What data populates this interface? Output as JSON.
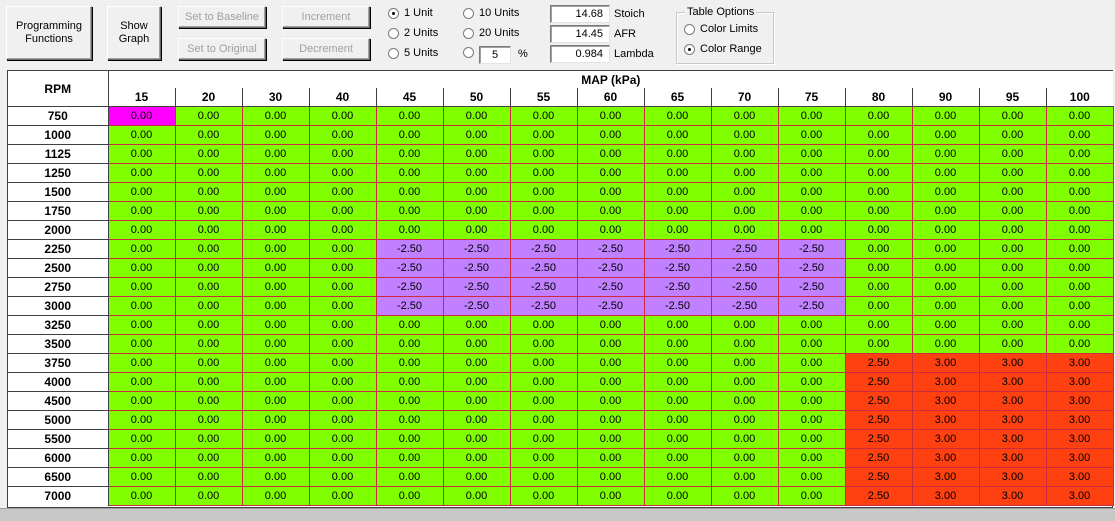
{
  "toolbar": {
    "programming_functions": "Programming\nFunctions",
    "show_graph": "Show\nGraph",
    "set_to_baseline": "Set to Baseline",
    "set_to_original": "Set to Original",
    "increment": "Increment",
    "decrement": "Decrement"
  },
  "increment_options": {
    "one_unit": "1 Unit",
    "two_units": "2 Units",
    "five_units": "5 Units",
    "ten_units": "10 Units",
    "twenty_units": "20 Units",
    "percent_value": "5",
    "percent_symbol": "%",
    "selected": "1 Unit"
  },
  "fuel": {
    "stoich_value": "14.68",
    "stoich_label": "Stoich",
    "afr_value": "14.45",
    "afr_label": "AFR",
    "lambda_value": "0.984",
    "lambda_label": "Lambda"
  },
  "table_options": {
    "title": "Table Options",
    "color_limits": "Color Limits",
    "color_range": "Color Range",
    "selected": "Color Range"
  },
  "colors": {
    "zero": "#80ff00",
    "negative": "#c080ff",
    "positive": "#ff4010",
    "selected": "#ff00ff",
    "grid_line": "#cc2a40"
  },
  "table": {
    "row_axis_label": "RPM",
    "col_axis_label": "MAP (kPa)",
    "columns": [
      "15",
      "20",
      "30",
      "40",
      "45",
      "50",
      "55",
      "60",
      "65",
      "70",
      "75",
      "80",
      "90",
      "95",
      "100"
    ],
    "rows": [
      "750",
      "1000",
      "1125",
      "1250",
      "1500",
      "1750",
      "2000",
      "2250",
      "2500",
      "2750",
      "3000",
      "3250",
      "3500",
      "3750",
      "4000",
      "4500",
      "5000",
      "5500",
      "6000",
      "6500",
      "7000"
    ],
    "selected_cell": [
      0,
      0
    ],
    "values": [
      [
        "0.00",
        "0.00",
        "0.00",
        "0.00",
        "0.00",
        "0.00",
        "0.00",
        "0.00",
        "0.00",
        "0.00",
        "0.00",
        "0.00",
        "0.00",
        "0.00",
        "0.00"
      ],
      [
        "0.00",
        "0.00",
        "0.00",
        "0.00",
        "0.00",
        "0.00",
        "0.00",
        "0.00",
        "0.00",
        "0.00",
        "0.00",
        "0.00",
        "0.00",
        "0.00",
        "0.00"
      ],
      [
        "0.00",
        "0.00",
        "0.00",
        "0.00",
        "0.00",
        "0.00",
        "0.00",
        "0.00",
        "0.00",
        "0.00",
        "0.00",
        "0.00",
        "0.00",
        "0.00",
        "0.00"
      ],
      [
        "0.00",
        "0.00",
        "0.00",
        "0.00",
        "0.00",
        "0.00",
        "0.00",
        "0.00",
        "0.00",
        "0.00",
        "0.00",
        "0.00",
        "0.00",
        "0.00",
        "0.00"
      ],
      [
        "0.00",
        "0.00",
        "0.00",
        "0.00",
        "0.00",
        "0.00",
        "0.00",
        "0.00",
        "0.00",
        "0.00",
        "0.00",
        "0.00",
        "0.00",
        "0.00",
        "0.00"
      ],
      [
        "0.00",
        "0.00",
        "0.00",
        "0.00",
        "0.00",
        "0.00",
        "0.00",
        "0.00",
        "0.00",
        "0.00",
        "0.00",
        "0.00",
        "0.00",
        "0.00",
        "0.00"
      ],
      [
        "0.00",
        "0.00",
        "0.00",
        "0.00",
        "0.00",
        "0.00",
        "0.00",
        "0.00",
        "0.00",
        "0.00",
        "0.00",
        "0.00",
        "0.00",
        "0.00",
        "0.00"
      ],
      [
        "0.00",
        "0.00",
        "0.00",
        "0.00",
        "-2.50",
        "-2.50",
        "-2.50",
        "-2.50",
        "-2.50",
        "-2.50",
        "-2.50",
        "0.00",
        "0.00",
        "0.00",
        "0.00"
      ],
      [
        "0.00",
        "0.00",
        "0.00",
        "0.00",
        "-2.50",
        "-2.50",
        "-2.50",
        "-2.50",
        "-2.50",
        "-2.50",
        "-2.50",
        "0.00",
        "0.00",
        "0.00",
        "0.00"
      ],
      [
        "0.00",
        "0.00",
        "0.00",
        "0.00",
        "-2.50",
        "-2.50",
        "-2.50",
        "-2.50",
        "-2.50",
        "-2.50",
        "-2.50",
        "0.00",
        "0.00",
        "0.00",
        "0.00"
      ],
      [
        "0.00",
        "0.00",
        "0.00",
        "0.00",
        "-2.50",
        "-2.50",
        "-2.50",
        "-2.50",
        "-2.50",
        "-2.50",
        "-2.50",
        "0.00",
        "0.00",
        "0.00",
        "0.00"
      ],
      [
        "0.00",
        "0.00",
        "0.00",
        "0.00",
        "0.00",
        "0.00",
        "0.00",
        "0.00",
        "0.00",
        "0.00",
        "0.00",
        "0.00",
        "0.00",
        "0.00",
        "0.00"
      ],
      [
        "0.00",
        "0.00",
        "0.00",
        "0.00",
        "0.00",
        "0.00",
        "0.00",
        "0.00",
        "0.00",
        "0.00",
        "0.00",
        "0.00",
        "0.00",
        "0.00",
        "0.00"
      ],
      [
        "0.00",
        "0.00",
        "0.00",
        "0.00",
        "0.00",
        "0.00",
        "0.00",
        "0.00",
        "0.00",
        "0.00",
        "0.00",
        "2.50",
        "3.00",
        "3.00",
        "3.00"
      ],
      [
        "0.00",
        "0.00",
        "0.00",
        "0.00",
        "0.00",
        "0.00",
        "0.00",
        "0.00",
        "0.00",
        "0.00",
        "0.00",
        "2.50",
        "3.00",
        "3.00",
        "3.00"
      ],
      [
        "0.00",
        "0.00",
        "0.00",
        "0.00",
        "0.00",
        "0.00",
        "0.00",
        "0.00",
        "0.00",
        "0.00",
        "0.00",
        "2.50",
        "3.00",
        "3.00",
        "3.00"
      ],
      [
        "0.00",
        "0.00",
        "0.00",
        "0.00",
        "0.00",
        "0.00",
        "0.00",
        "0.00",
        "0.00",
        "0.00",
        "0.00",
        "2.50",
        "3.00",
        "3.00",
        "3.00"
      ],
      [
        "0.00",
        "0.00",
        "0.00",
        "0.00",
        "0.00",
        "0.00",
        "0.00",
        "0.00",
        "0.00",
        "0.00",
        "0.00",
        "2.50",
        "3.00",
        "3.00",
        "3.00"
      ],
      [
        "0.00",
        "0.00",
        "0.00",
        "0.00",
        "0.00",
        "0.00",
        "0.00",
        "0.00",
        "0.00",
        "0.00",
        "0.00",
        "2.50",
        "3.00",
        "3.00",
        "3.00"
      ],
      [
        "0.00",
        "0.00",
        "0.00",
        "0.00",
        "0.00",
        "0.00",
        "0.00",
        "0.00",
        "0.00",
        "0.00",
        "0.00",
        "2.50",
        "3.00",
        "3.00",
        "3.00"
      ],
      [
        "0.00",
        "0.00",
        "0.00",
        "0.00",
        "0.00",
        "0.00",
        "0.00",
        "0.00",
        "0.00",
        "0.00",
        "0.00",
        "2.50",
        "3.00",
        "3.00",
        "3.00"
      ]
    ]
  }
}
